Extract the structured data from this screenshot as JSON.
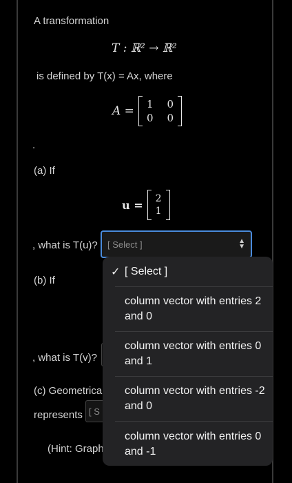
{
  "intro": "A transformation",
  "math_T": "T : ℝ² → ℝ²",
  "defined_by": "is defined by T(x) = Ax, where",
  "matrix_lhs": "A =",
  "matrix_A": [
    [
      "1",
      "0"
    ],
    [
      "0",
      "0"
    ]
  ],
  "dot": ".",
  "part_a_label": "(a)  If",
  "vector_lhs": "u =",
  "vector_u": [
    "2",
    "1"
  ],
  "question_a": ", what is T(u)?",
  "select_placeholder": "[ Select ]",
  "part_b_label": "(b)  If",
  "question_b": ", what is T(v)?",
  "part_c_label": "(c)  Geometrica",
  "represents": "represents",
  "select_stub_c": "[ S",
  "hint": "(Hint: Graph",
  "dropdown": {
    "selected_mark": "✓",
    "options": [
      "[ Select ]",
      "column vector with entries 2 and 0",
      "column vector with entries 0 and 1",
      "column vector with entries -2 and 0",
      "column vector with entries 0 and -1"
    ]
  },
  "colors": {
    "accent": "#4a8bdc",
    "background": "#000000",
    "menu_bg": "#232325"
  }
}
